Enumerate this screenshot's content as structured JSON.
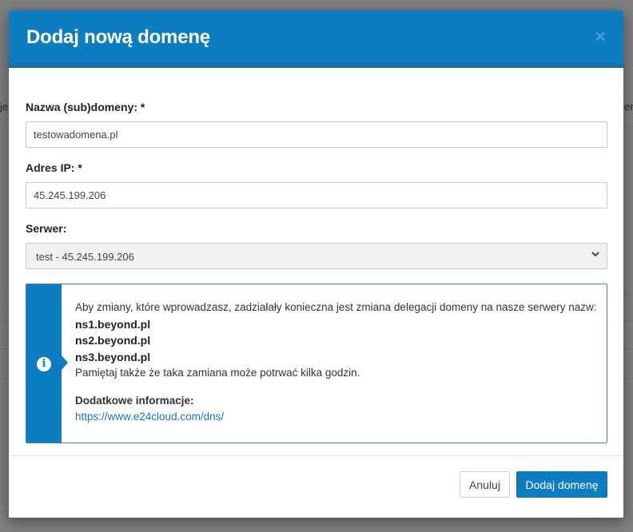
{
  "backdrop": {
    "left_fragment": "je",
    "right_fragment": "ent"
  },
  "modal": {
    "title": "Dodaj nową domenę",
    "close_glyph": "×"
  },
  "form": {
    "domain": {
      "label": "Nazwa (sub)domeny: *",
      "value": "testowadomena.pl"
    },
    "ip": {
      "label": "Adres IP: *",
      "value": "45.245.199.206"
    },
    "server": {
      "label": "Serwer:",
      "selected": "test - 45.245.199.206"
    }
  },
  "info": {
    "icon": "info-icon",
    "intro": "Aby zmiany, które wprowadzasz, zadziałały konieczna jest zmiana delegacji domeny na nasze serwery nazw:",
    "nameservers": [
      "ns1.beyond.pl",
      "ns2.beyond.pl",
      "ns3.beyond.pl"
    ],
    "note": "Pamiętaj także że taka zamiana może potrwać kilka godzin.",
    "more_title": "Dodatkowe informacje:",
    "link": "https://www.e24cloud.com/dns/"
  },
  "footer": {
    "cancel_label": "Anuluj",
    "submit_label": "Dodaj domenę"
  },
  "colors": {
    "accent": "#0b7dc0",
    "link": "#1a74b4"
  }
}
